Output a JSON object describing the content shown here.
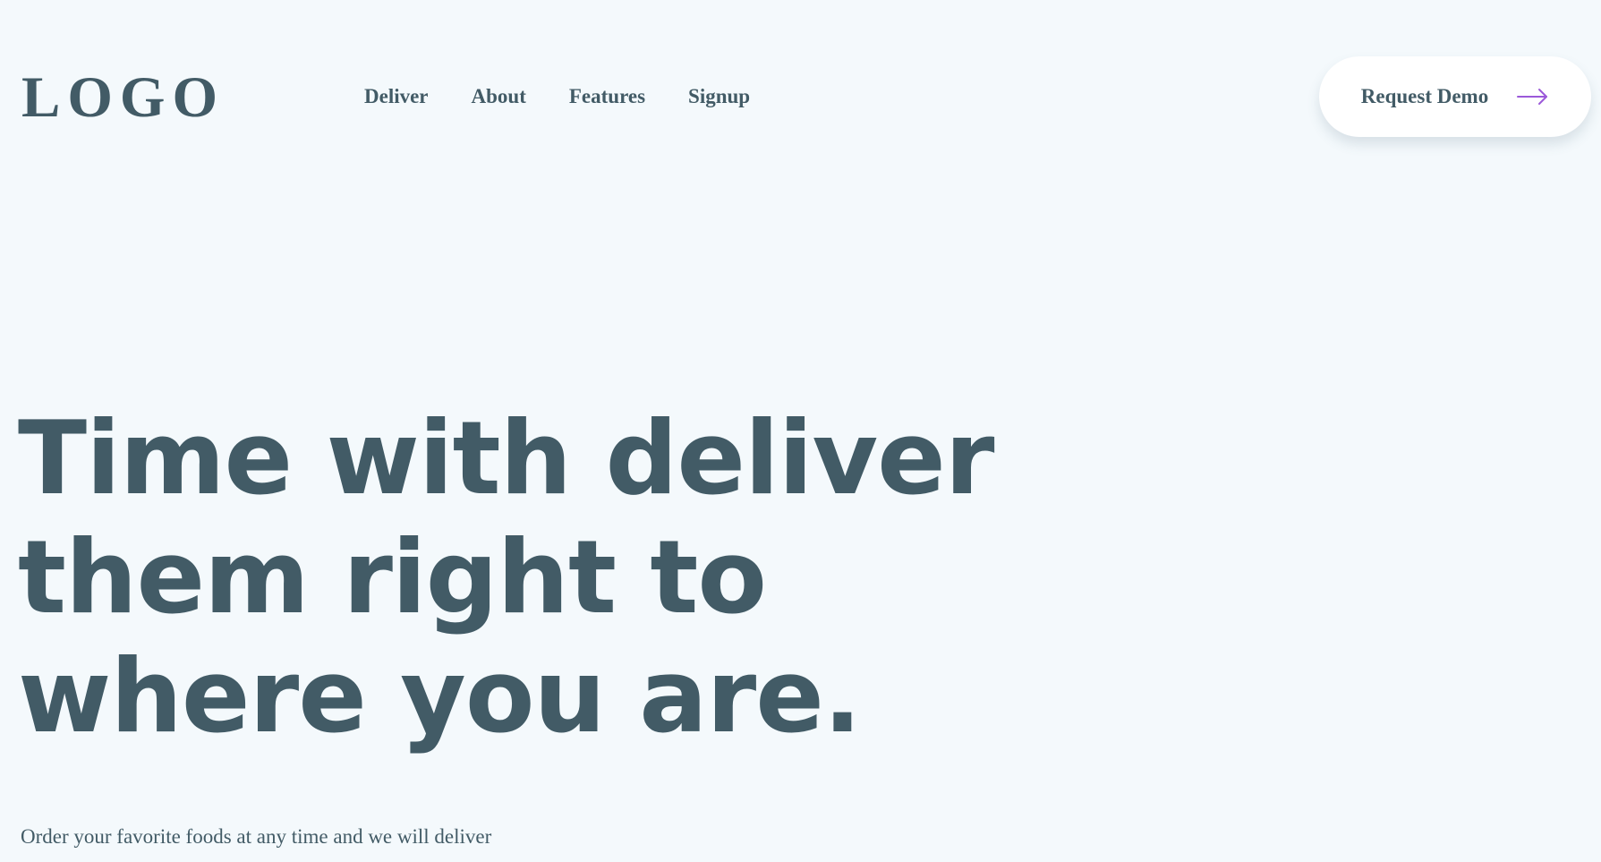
{
  "header": {
    "logo": "LOGO",
    "nav": [
      "Deliver",
      "About",
      "Features",
      "Signup"
    ],
    "cta": {
      "label": "Request Demo",
      "icon": "arrow-right-icon",
      "icon_color": "#9b59d9"
    }
  },
  "hero": {
    "title_lines": [
      "Time with deliver",
      "them right to",
      "where you are."
    ],
    "subtitle": "Order your favorite foods at any time and we will deliver"
  },
  "colors": {
    "background": "#f4f9fc",
    "text": "#425b66",
    "button_bg": "#ffffff",
    "accent": "#9b59d9"
  }
}
